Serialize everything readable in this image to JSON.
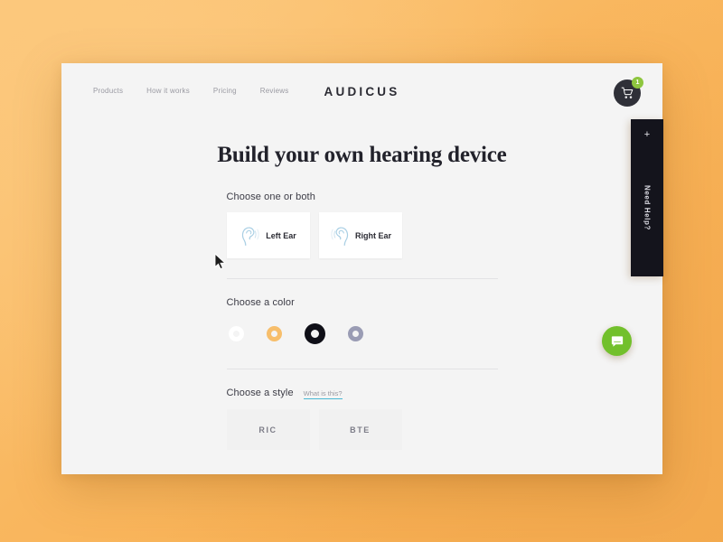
{
  "window": {
    "nav": {
      "links": [
        {
          "label": "Products"
        },
        {
          "label": "How it works"
        },
        {
          "label": "Pricing"
        },
        {
          "label": "Reviews"
        }
      ],
      "logo": "AUDICUS",
      "cart": {
        "icon": "shopping-cart-icon",
        "badge_count": "1",
        "badge_color": "#8ec63f",
        "button_color": "#2f3038"
      }
    },
    "page_title": "Build your own hearing device",
    "builder": {
      "ear_section": {
        "label": "Choose one or both",
        "options": [
          {
            "label": "Left Ear",
            "icon": "ear-left-icon"
          },
          {
            "label": "Right Ear",
            "icon": "ear-right-icon"
          }
        ]
      },
      "color_section": {
        "label": "Choose a color",
        "swatches": [
          {
            "name": "white",
            "color": "#ffffff",
            "selected": false
          },
          {
            "name": "beige",
            "color": "#f7be6b",
            "selected": false
          },
          {
            "name": "black",
            "color": "#0f0f17",
            "selected": true
          },
          {
            "name": "grey",
            "color": "#9a9cb4",
            "selected": false
          }
        ]
      },
      "style_section": {
        "label": "Choose a style",
        "helper_link": "What is this?",
        "helper_link_underline_color": "#49b8d4",
        "options": [
          {
            "label": "RIC"
          },
          {
            "label": "BTE"
          }
        ]
      }
    }
  },
  "need_help": {
    "plus": "+",
    "label": "Need Help?",
    "background": "#14141c"
  },
  "chat": {
    "icon": "chat-bubble-icon",
    "color": "#72c02c"
  },
  "cursor": {
    "icon": "mouse-pointer-icon"
  }
}
